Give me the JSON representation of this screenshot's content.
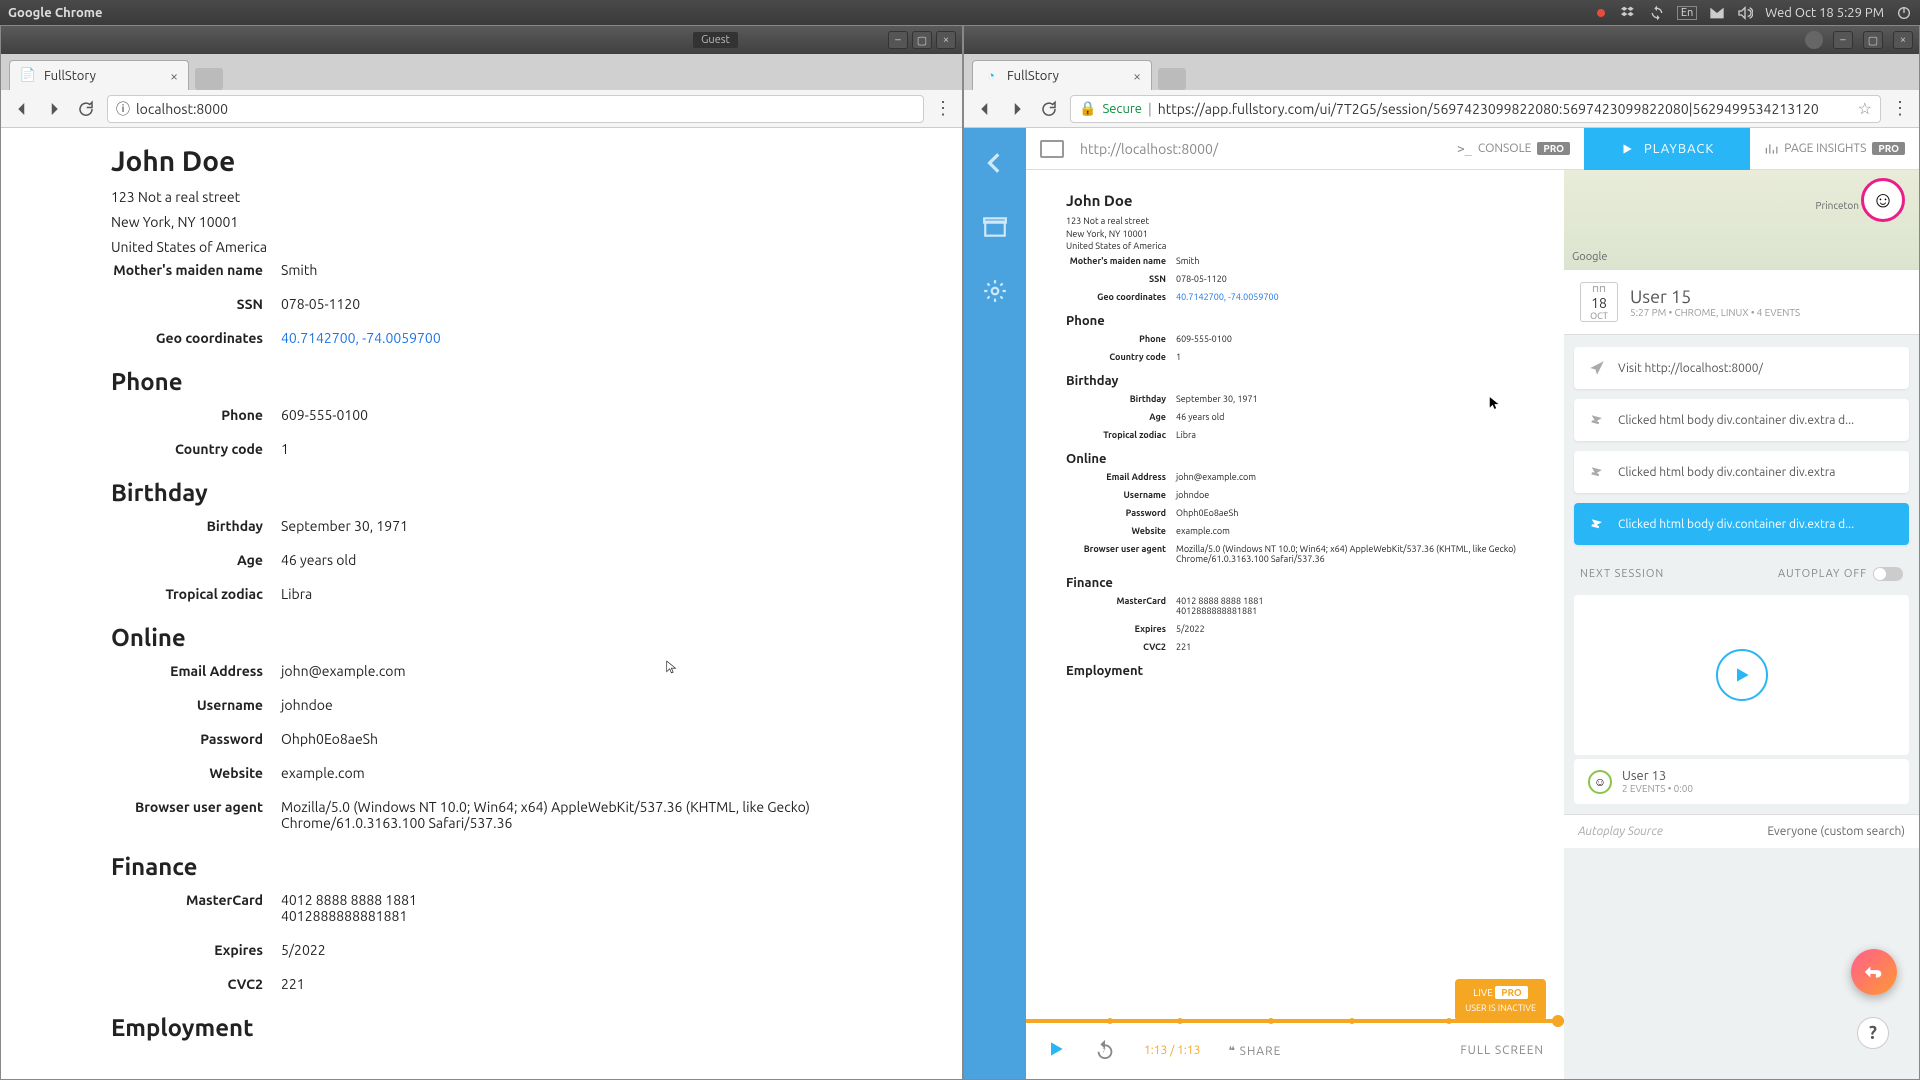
{
  "menubar": {
    "title": "Google Chrome",
    "datetime": "Wed Oct 18  5:29 PM",
    "lang": "En"
  },
  "leftWindow": {
    "guestLabel": "Guest",
    "tabTitle": "FullStory",
    "address": "localhost:8000",
    "profile": {
      "name": "John Doe",
      "addr1": "123 Not a real street",
      "addr2": "New York, NY 10001",
      "addr3": "United States of America",
      "fields": {
        "maiden": {
          "label": "Mother's maiden name",
          "value": "Smith"
        },
        "ssn": {
          "label": "SSN",
          "value": "078-05-1120"
        },
        "geo": {
          "label": "Geo coordinates",
          "value": "40.7142700, -74.0059700"
        }
      },
      "phoneHeading": "Phone",
      "phone": {
        "label": "Phone",
        "value": "609-555-0100"
      },
      "country": {
        "label": "Country code",
        "value": "1"
      },
      "birthdayHeading": "Birthday",
      "birthday": {
        "label": "Birthday",
        "value": "September 30, 1971"
      },
      "age": {
        "label": "Age",
        "value": "46 years old"
      },
      "zodiac": {
        "label": "Tropical zodiac",
        "value": "Libra"
      },
      "onlineHeading": "Online",
      "email": {
        "label": "Email Address",
        "value": "john@example.com"
      },
      "username": {
        "label": "Username",
        "value": "johndoe"
      },
      "password": {
        "label": "Password",
        "value": "Ohph0Eo8aeSh"
      },
      "website": {
        "label": "Website",
        "value": "example.com"
      },
      "ua": {
        "label": "Browser user agent",
        "value": "Mozilla/5.0 (Windows NT 10.0; Win64; x64) AppleWebKit/537.36 (KHTML, like Gecko) Chrome/61.0.3163.100 Safari/537.36"
      },
      "financeHeading": "Finance",
      "card": {
        "label": "MasterCard",
        "value1": "4012 8888 8888 1881",
        "value2": "4012888888881881"
      },
      "expires": {
        "label": "Expires",
        "value": "5/2022"
      },
      "cvc": {
        "label": "CVC2",
        "value": "221"
      },
      "employmentHeading": "Employment"
    }
  },
  "rightWindow": {
    "tabTitle": "FullStory",
    "secureLabel": "Secure",
    "address": "https://app.fullstory.com/ui/7T2G5/session/5697423099822080:5697423099822080|5629499534213120",
    "topbar": {
      "replayUrl": "http://localhost:8000/",
      "console": "CONSOLE",
      "pro": "PRO",
      "playback": "PLAYBACK",
      "insights": "PAGE INSIGHTS"
    },
    "userCard": {
      "dateMonth": "OCT",
      "dateDay": "18",
      "name": "User 15",
      "meta": "5:27 PM • CHROME, LINUX • 4 EVENTS"
    },
    "events": [
      {
        "text": "Visit http://localhost:8000/",
        "icon": "navigate",
        "active": false
      },
      {
        "text": "Clicked html body div.container div.extra d...",
        "icon": "click",
        "active": false
      },
      {
        "text": "Clicked html body div.container div.extra",
        "icon": "click",
        "active": false
      },
      {
        "text": "Clicked html body div.container div.extra d...",
        "icon": "click",
        "active": true
      }
    ],
    "nextSession": {
      "label": "NEXT SESSION",
      "autoplay": "AUTOPLAY OFF"
    },
    "sessionUser": {
      "name": "User 13",
      "meta": "2 EVENTS • 0:00"
    },
    "footer": {
      "source": "Autoplay Source",
      "value": "Everyone (custom search)"
    },
    "liveBadge": {
      "live": "LIVE",
      "pro": "PRO",
      "inactive": "USER IS INACTIVE"
    },
    "controls": {
      "time": "1:13 / 1:13",
      "share": "SHARE",
      "fullscreen": "FULL SCREEN"
    },
    "map": {
      "google": "Google",
      "city": "Princeton"
    }
  }
}
